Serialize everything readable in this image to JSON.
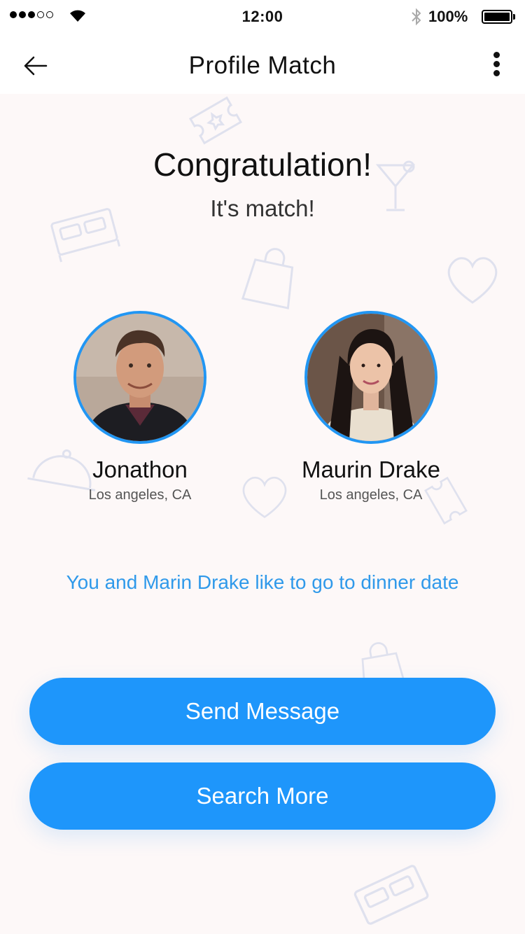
{
  "status_bar": {
    "time": "12:00",
    "battery": "100%"
  },
  "nav": {
    "title": "Profile Match"
  },
  "headline": "Congratulation!",
  "subheadline": "It's match!",
  "profiles": [
    {
      "name": "Jonathon",
      "location": "Los angeles, CA"
    },
    {
      "name": "Maurin Drake",
      "location": "Los angeles, CA"
    }
  ],
  "match_note": "You and Marin Drake like to go to dinner date",
  "buttons": {
    "send_message": "Send Message",
    "search_more": "Search More"
  },
  "colors": {
    "accent": "#1e96fb",
    "note_text": "#2f99ea",
    "background": "#fdf8f8"
  },
  "icons": [
    "back-arrow-icon",
    "more-vertical-icon",
    "wifi-icon",
    "bluetooth-icon",
    "battery-icon",
    "ticket-icon",
    "cocktail-icon",
    "bed-icon",
    "shopping-bag-icon",
    "heart-icon",
    "food-cloche-icon"
  ]
}
